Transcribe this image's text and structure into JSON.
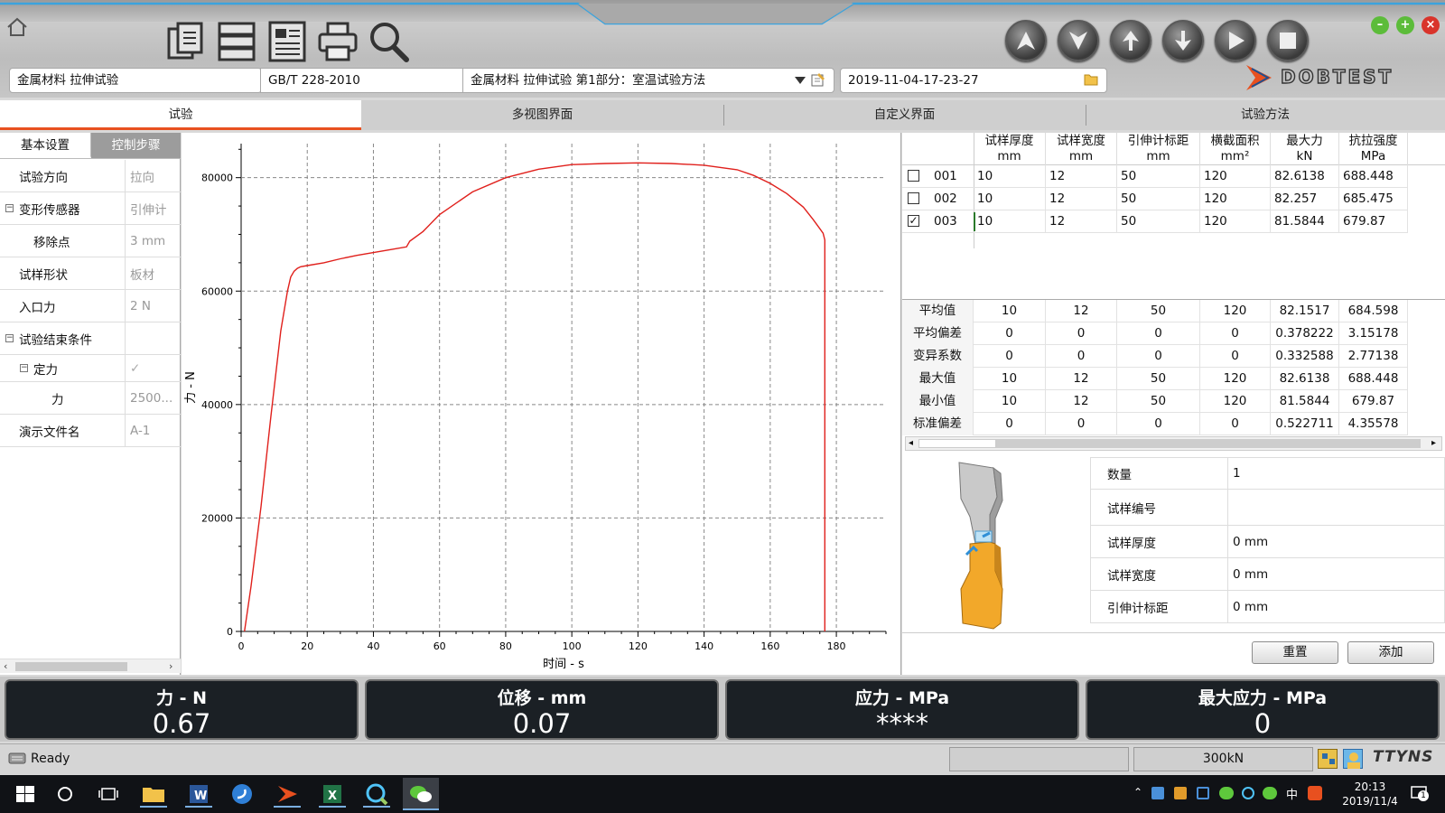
{
  "header": {
    "method_category": "金属材料 拉伸试验",
    "standard": "GB/T 228-2010",
    "method_name": "金属材料 拉伸试验 第1部分：室温试验方法",
    "timestamp": "2019-11-04-17-23-27",
    "logo_text": "DOBTEST"
  },
  "tabs": [
    {
      "label": "试验",
      "active": true
    },
    {
      "label": "多视图界面",
      "active": false
    },
    {
      "label": "自定义界面",
      "active": false
    },
    {
      "label": "试验方法",
      "active": false
    }
  ],
  "left_panel": {
    "tabs": [
      "基本设置",
      "控制步骤"
    ],
    "properties": [
      {
        "key": "试验方向",
        "value": "拉向"
      },
      {
        "key": "变形传感器",
        "value": "引伸计"
      },
      {
        "key": "移除点",
        "value": "3 mm"
      },
      {
        "key": "试样形状",
        "value": "板材"
      },
      {
        "key": "入口力",
        "value": "2 N"
      },
      {
        "key": "试验结束条件",
        "value": ""
      },
      {
        "key": "定力",
        "value": "✓"
      },
      {
        "key": "力",
        "value": "2500..."
      },
      {
        "key": "演示文件名",
        "value": "A-1"
      }
    ]
  },
  "chart_data": {
    "type": "line",
    "xlabel": "时间 - s",
    "ylabel": "力 - N",
    "xlim": [
      0,
      195
    ],
    "ylim": [
      0,
      86000
    ],
    "x_ticks": [
      0,
      20,
      40,
      60,
      80,
      100,
      120,
      140,
      160,
      180
    ],
    "y_ticks": [
      0,
      20000,
      40000,
      60000,
      80000
    ],
    "grid": true,
    "color": "#e0201c",
    "series": [
      {
        "x": [
          1,
          3,
          6,
          9,
          12,
          14,
          15,
          16,
          17,
          18,
          20,
          25,
          30,
          35,
          40,
          45,
          50,
          51,
          55,
          60,
          70,
          80,
          90,
          100,
          110,
          120,
          130,
          140,
          150,
          155,
          160,
          165,
          170,
          173,
          175,
          176,
          176.5,
          176.5
        ],
        "y": [
          0,
          8000,
          22000,
          38000,
          53000,
          60000,
          62500,
          63500,
          64000,
          64300,
          64500,
          65000,
          65700,
          66300,
          66800,
          67300,
          67800,
          68800,
          70500,
          73500,
          77500,
          80000,
          81500,
          82300,
          82500,
          82600,
          82500,
          82200,
          81400,
          80400,
          79000,
          77200,
          74800,
          72600,
          71000,
          70200,
          69000,
          0
        ]
      }
    ]
  },
  "results_table": {
    "headers": [
      {
        "l1": "试样厚度",
        "l2": "mm"
      },
      {
        "l1": "试样宽度",
        "l2": "mm"
      },
      {
        "l1": "引伸计标距",
        "l2": "mm"
      },
      {
        "l1": "横截面积",
        "l2": "mm²"
      },
      {
        "l1": "最大力",
        "l2": "kN"
      },
      {
        "l1": "抗拉强度",
        "l2": "MPa"
      }
    ],
    "rows": [
      {
        "id": "001",
        "checked": false,
        "values": [
          "10",
          "12",
          "50",
          "120",
          "82.6138",
          "688.448"
        ]
      },
      {
        "id": "002",
        "checked": false,
        "values": [
          "10",
          "12",
          "50",
          "120",
          "82.257",
          "685.475"
        ]
      },
      {
        "id": "003",
        "checked": true,
        "values": [
          "10",
          "12",
          "50",
          "120",
          "81.5844",
          "679.87"
        ]
      }
    ]
  },
  "stats_table": {
    "rows": [
      {
        "label": "平均值",
        "values": [
          "10",
          "12",
          "50",
          "120",
          "82.1517",
          "684.598"
        ]
      },
      {
        "label": "平均偏差",
        "values": [
          "0",
          "0",
          "0",
          "0",
          "0.378222",
          "3.15178"
        ]
      },
      {
        "label": "变异系数",
        "values": [
          "0",
          "0",
          "0",
          "0",
          "0.332588",
          "2.77138"
        ]
      },
      {
        "label": "最大值",
        "values": [
          "10",
          "12",
          "50",
          "120",
          "82.6138",
          "688.448"
        ]
      },
      {
        "label": "最小值",
        "values": [
          "10",
          "12",
          "50",
          "120",
          "81.5844",
          "679.87"
        ]
      },
      {
        "label": "标准偏差",
        "values": [
          "0",
          "0",
          "0",
          "0",
          "0.522711",
          "4.35578"
        ]
      }
    ]
  },
  "specimen_form": {
    "fields": [
      {
        "label": "数量",
        "value": "1"
      },
      {
        "label": "试样编号",
        "value": ""
      },
      {
        "label": "试样厚度",
        "value": "0 mm"
      },
      {
        "label": "试样宽度",
        "value": "0 mm"
      },
      {
        "label": "引伸计标距",
        "value": "0 mm"
      }
    ],
    "reset_label": "重置",
    "add_label": "添加"
  },
  "readouts": [
    {
      "title": "力 - N",
      "value": "0.67"
    },
    {
      "title": "位移 - mm",
      "value": "0.07"
    },
    {
      "title": "应力 - MPa",
      "value": "****"
    },
    {
      "title": "最大应力 - MPa",
      "value": "0"
    }
  ],
  "status": {
    "text": "Ready",
    "capacity": "300kN",
    "brand": "TTYNS"
  },
  "taskbar": {
    "time": "20:13",
    "date": "2019/11/4",
    "ime": "中",
    "notification_count": "1"
  },
  "colors": {
    "accent": "#e8501f",
    "curve": "#e0201c",
    "readout_bg": "#1b2025",
    "taskbar_bg": "#101216"
  }
}
